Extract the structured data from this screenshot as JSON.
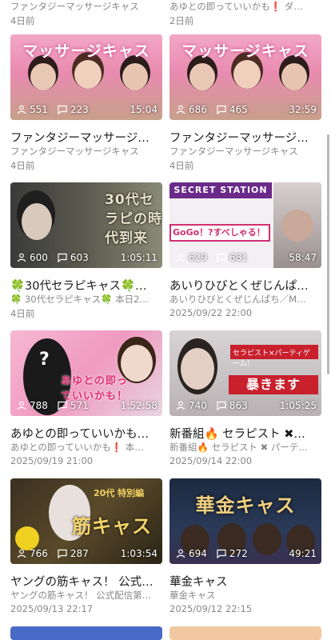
{
  "top_partial": [
    {
      "channel": "ファンタジーマッサージキャス",
      "date": "4日前"
    },
    {
      "channel": "あゆとの即っていいかも❗ ダ…",
      "date": "2日前"
    }
  ],
  "videos": [
    {
      "headline": "マッサージキャス",
      "viewers": "551",
      "comments": "223",
      "duration": "15:04",
      "title": "ファンタジーマッサージ…",
      "channel": "ファンタジーマッサージキャス",
      "date": "4日前"
    },
    {
      "headline": "マッサージキャス",
      "viewers": "686",
      "comments": "465",
      "duration": "32:59",
      "title": "ファンタジーマッサージ…",
      "channel": "ファンタジーマッサージキャス",
      "date": "4日前"
    },
    {
      "headline": "30代セラピの時代到来",
      "viewers": "600",
      "comments": "603",
      "duration": "1:05:11",
      "title": "🍀30代セラピキャス🍀…",
      "channel": "🍀 30代セラピキャス🍀 本日2…",
      "date": "4日前"
    },
    {
      "headline": "SECRET STATION",
      "viewers": "629",
      "comments": "681",
      "duration": "58:47",
      "title": "あいりひびとくぜじんぱ…",
      "channel": "あいりひびとくぜじんぱち／M…",
      "date": "2025/09/22 22:00"
    },
    {
      "headline": "あゆとの即っていいかも！",
      "viewers": "788",
      "comments": "571",
      "duration": "1:52:58",
      "title": "あゆとの即っていいかも…",
      "channel": "あゆとの即っていいかも❗ 本…",
      "date": "2025/09/19 21:00"
    },
    {
      "headline": "暴きます",
      "viewers": "740",
      "comments": "863",
      "duration": "1:05:25",
      "title": "新番組🔥 セラピスト ✖…",
      "channel": "新番組🔥 セラピスト ✖ パーテ…",
      "date": "2025/09/14 22:00"
    },
    {
      "headline": "筋キャス",
      "viewers": "766",
      "comments": "287",
      "duration": "1:03:54",
      "title": "ヤングの筋キャス！ 公式…",
      "channel": "ヤングの筋キャス！ 公式配信第…",
      "date": "2025/09/13 22:17"
    },
    {
      "headline": "華金キャス",
      "viewers": "694",
      "comments": "272",
      "duration": "49:21",
      "title": "華金キャス",
      "channel": "華金キャス",
      "date": "2025/09/12 22:15"
    }
  ],
  "colors": {
    "meta": "#888888",
    "title": "#1a1a1a"
  }
}
